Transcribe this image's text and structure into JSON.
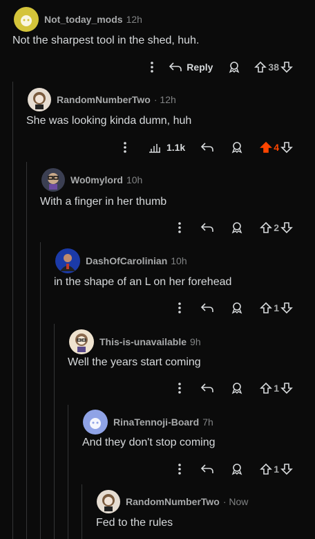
{
  "comments": [
    {
      "user": "Not_today_mods",
      "time": "12h",
      "text": "Not the sharpest tool in the shed, huh.",
      "reply_label": "Reply",
      "score": "38",
      "avatar_color": "#d4c43a"
    },
    {
      "user": "RandomNumberTwo",
      "time": "· 12h",
      "text": "She was looking kinda dumn, huh",
      "views": "1.1k",
      "score": "4",
      "avatar_color": "#e6ddd2"
    },
    {
      "user": "Wo0mylord",
      "time": "10h",
      "text": "With a finger in her thumb",
      "score": "2",
      "avatar_color": "#3b3f52"
    },
    {
      "user": "DashOfCarolinian",
      "time": "10h",
      "text": "in the shape of an L on her forehead",
      "score": "1",
      "avatar_color": "#1b3aa8"
    },
    {
      "user": "This-is-unavailable",
      "time": "9h",
      "text": "Well the years start coming",
      "score": "1",
      "avatar_color": "#efe3cf"
    },
    {
      "user": "RinaTennoji-Board",
      "time": "7h",
      "text": "And they don't stop coming",
      "score": "1",
      "avatar_color": "#8fa3e6"
    },
    {
      "user": "RandomNumberTwo",
      "time": "· Now",
      "text": "Fed to the rules",
      "avatar_color": "#e6ddd2"
    }
  ],
  "colors": {
    "upvoted": "#ff4500",
    "text": "#d7dadc",
    "muted": "#818384"
  }
}
